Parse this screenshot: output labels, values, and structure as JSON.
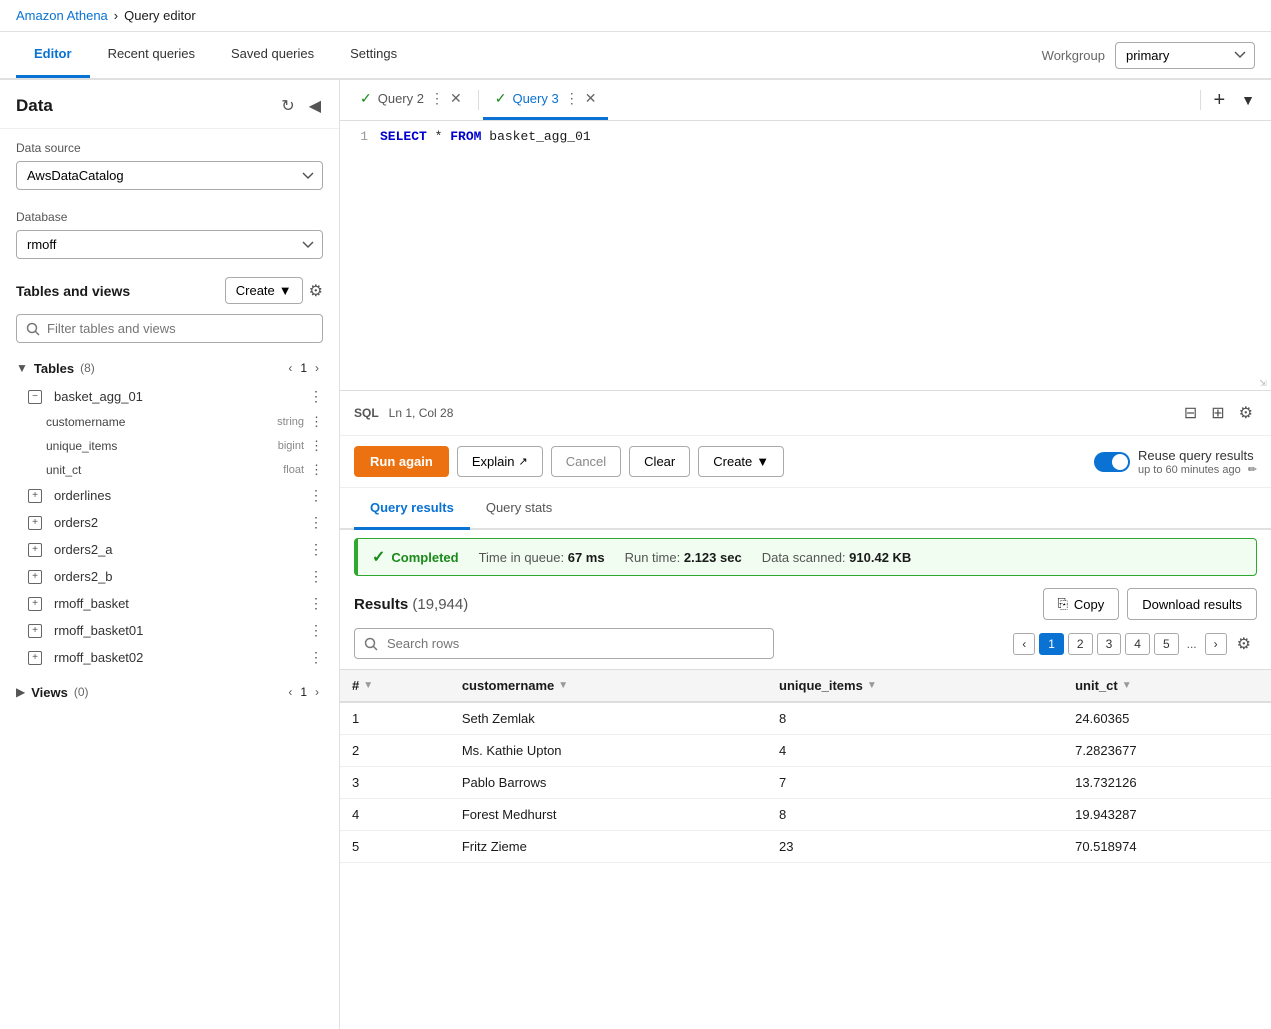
{
  "breadcrumb": {
    "home": "Amazon Athena",
    "sep": "›",
    "current": "Query editor"
  },
  "topNav": {
    "tabs": [
      {
        "id": "editor",
        "label": "Editor",
        "active": true
      },
      {
        "id": "recent-queries",
        "label": "Recent queries",
        "active": false
      },
      {
        "id": "saved-queries",
        "label": "Saved queries",
        "active": false
      },
      {
        "id": "settings",
        "label": "Settings",
        "active": false
      }
    ],
    "workgroup_label": "Workgroup",
    "workgroup_value": "primary"
  },
  "sidebar": {
    "title": "Data",
    "data_source_label": "Data source",
    "data_source_value": "AwsDataCatalog",
    "database_label": "Database",
    "database_value": "rmoff",
    "tables_title": "Tables and views",
    "create_btn": "Create",
    "filter_placeholder": "Filter tables and views",
    "tables_group": "Tables",
    "tables_count": "(8)",
    "tables_page": "1",
    "tables": [
      {
        "name": "basket_agg_01",
        "expanded": true,
        "columns": [
          {
            "name": "customername",
            "type": "string"
          },
          {
            "name": "unique_items",
            "type": "bigint"
          },
          {
            "name": "unit_ct",
            "type": "float"
          }
        ]
      },
      {
        "name": "orderlines",
        "expanded": false,
        "columns": []
      },
      {
        "name": "orders2",
        "expanded": false,
        "columns": []
      },
      {
        "name": "orders2_a",
        "expanded": false,
        "columns": []
      },
      {
        "name": "orders2_b",
        "expanded": false,
        "columns": []
      },
      {
        "name": "rmoff_basket",
        "expanded": false,
        "columns": []
      },
      {
        "name": "rmoff_basket01",
        "expanded": false,
        "columns": []
      },
      {
        "name": "rmoff_basket02",
        "expanded": false,
        "columns": []
      }
    ],
    "views_group": "Views",
    "views_count": "(0)",
    "views_page": "1"
  },
  "queryTabs": [
    {
      "id": "query2",
      "label": "Query 2",
      "active": false,
      "status": "success"
    },
    {
      "id": "query3",
      "label": "Query 3",
      "active": true,
      "status": "success"
    }
  ],
  "codeEditor": {
    "line1": "SELECT * FROM basket_agg_01",
    "sql_label": "SQL",
    "cursor_pos": "Ln 1, Col 28"
  },
  "actionBar": {
    "run_again": "Run again",
    "explain": "Explain",
    "cancel": "Cancel",
    "clear": "Clear",
    "create": "Create",
    "reuse_label": "Reuse query results",
    "reuse_sub": "up to 60 minutes ago"
  },
  "results": {
    "query_results_tab": "Query results",
    "query_stats_tab": "Query stats",
    "status": "Completed",
    "time_in_queue_label": "Time in queue:",
    "time_in_queue_val": "67 ms",
    "run_time_label": "Run time:",
    "run_time_val": "2.123 sec",
    "data_scanned_label": "Data scanned:",
    "data_scanned_val": "910.42 KB",
    "title": "Results",
    "count": "(19,944)",
    "copy_btn": "Copy",
    "download_btn": "Download results",
    "search_placeholder": "Search rows",
    "pages": [
      "1",
      "2",
      "3",
      "4",
      "5",
      "..."
    ],
    "columns": [
      "#",
      "customername",
      "unique_items",
      "unit_ct"
    ],
    "rows": [
      {
        "num": "1",
        "customername": "Seth Zemlak",
        "unique_items": "8",
        "unit_ct": "24.60365"
      },
      {
        "num": "2",
        "customername": "Ms. Kathie Upton",
        "unique_items": "4",
        "unit_ct": "7.2823677"
      },
      {
        "num": "3",
        "customername": "Pablo Barrows",
        "unique_items": "7",
        "unit_ct": "13.732126"
      },
      {
        "num": "4",
        "customername": "Forest Medhurst",
        "unique_items": "8",
        "unit_ct": "19.943287"
      },
      {
        "num": "5",
        "customername": "Fritz Zieme",
        "unique_items": "23",
        "unit_ct": "70.518974"
      }
    ]
  }
}
